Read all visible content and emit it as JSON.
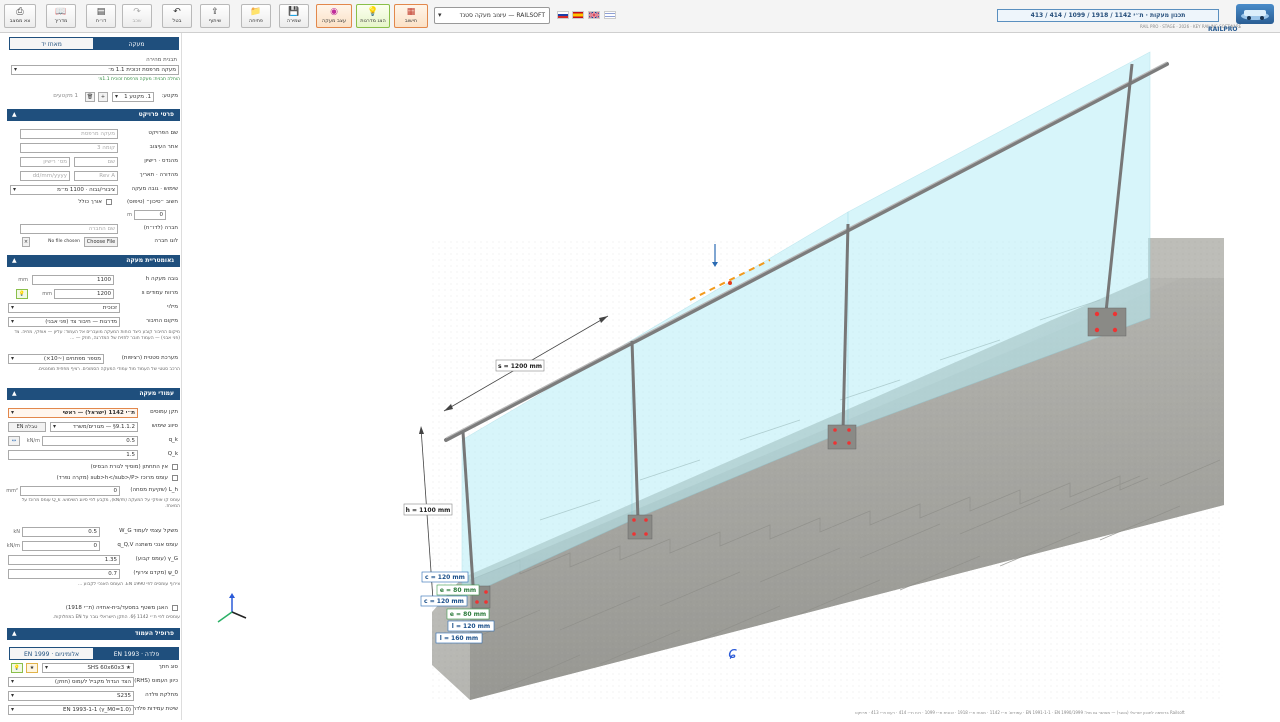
{
  "toolbar": {
    "buttons": [
      {
        "name": "export-pdf-button",
        "icon": "⎙",
        "label": "צא ממצב"
      },
      {
        "name": "guide-button",
        "icon": "📖",
        "label": "מדריך"
      },
      {
        "name": "report-button",
        "icon": "▤",
        "label": "דו״ח"
      },
      {
        "name": "redo-button",
        "icon": "↷",
        "label": "שכב"
      },
      {
        "name": "undo-button",
        "icon": "↶",
        "label": "בטל"
      },
      {
        "name": "share-button",
        "icon": "⇪",
        "label": "שיתוף"
      },
      {
        "name": "open-button",
        "icon": "📁",
        "label": "פתיחה"
      },
      {
        "name": "save-button",
        "icon": "💾",
        "label": "שמירה"
      },
      {
        "name": "design-railing-button",
        "icon": "◉",
        "label": "עצב מעקה"
      },
      {
        "name": "show-steps-button",
        "icon": "💡",
        "label": "הצג מדרגות"
      },
      {
        "name": "calc-button",
        "icon": "▦",
        "label": "חישוב"
      }
    ],
    "design_select": "RAILSOFT — עיצוב מעקה סטנד",
    "languages": [
      "RU",
      "ES",
      "UK",
      "IL"
    ]
  },
  "header": {
    "title": "תכנון מעקות · ת״י 1142 / 1918 / 1099 / 414 / 413",
    "sub": "RAIL PRO · STAGE · 2026 · KEY RAILING SOFTWARE",
    "corner_brand": "RAILPRO"
  },
  "panel": {
    "tabs": [
      "מעקה",
      "מאחז יד"
    ],
    "template_label": "תבנית מהירה",
    "template_value": "מעקה מרפסת זכוכית 1.1 מ׳",
    "template_note": "הוחלה תבנית: מעקה מרפסת זכוכית 1.1מ׳",
    "segment_label": "מקטע:",
    "segment_value": "1. מקטע 1",
    "segment_count": "1 מקטעים",
    "sections": {
      "project": "פרטי פרויקט",
      "geometry": "גאומטריית מעקה",
      "posts": "עמודי מעקה",
      "profile": "פרופיל העמוד"
    },
    "project": {
      "project_name_label": "שם הפרויקט",
      "project_name_ph": "מעקה מרפסת",
      "site_label": "אתר העיצוב",
      "site_ph": "קומה 3",
      "engineer_label": "מהנדס · רישיון",
      "engineer_name_ph": "שם",
      "engineer_lic_ph": "מס׳ רישיון",
      "revision_label": "מהדורה · תאריך",
      "revision_ph": "Rev A",
      "date_ph": "dd/mm/yyyy",
      "usage_label": "שימוש · גובה מעקה",
      "usage_value": "ציבורי/גבוה · 1100 מ״מ",
      "wind_label": "חשוב ״סיכון״ (טיפוס)",
      "wind_check": "אורך כולל",
      "wind_value": "0",
      "wind_unit": "m",
      "company_label": "חברה (לדו״ח)",
      "company_ph": "שם החברה",
      "logo_label": "לוגו חברה",
      "file_btn": "Choose File",
      "file_none": "No file chosen"
    },
    "geometry": {
      "height_label": "גובה מעקה h",
      "height_value": "1100",
      "height_unit": "mm",
      "spacing_label": "מרווח עמודים s",
      "spacing_value": "1200",
      "spacing_unit": "mm",
      "infill_label": "מילוי",
      "infill_value": "זכוכית",
      "mount_label": "מיקום החיבור",
      "mount_value": "מדרגות — חיבור צד (פני אבני)",
      "mount_note": "מיקום החיבור קובע כיצד כוחות המעקה מועברים אל העמוד: עליון — אופקי, מחיה. צד (פני אבני) — העמוד חובר לחזית של המדרגה, חוזק — ...",
      "system_label": "מערכת סטטית (רציפות)",
      "system_value": "מספר מפתחים (~10×)",
      "system_note": "הרכב סטטי של העמוד מול עמודי המעקה הסמוכים. רציף מפחית מומנטים."
    },
    "posts": {
      "standard_label": "תקן עמוסים",
      "standard_value": "ת״י 1142 (ישראל) — ראשי",
      "usage_cls_label": "סיווג שימוש",
      "usage_cls_value": "9.1.1.2§ — מגורים/משרד",
      "en_btn": "טבלת EN",
      "qk_label": "q_k",
      "qk_value": "0.5",
      "qk_unit": "kN/m",
      "qc_label": "Q_k",
      "qc_value": "1.5",
      "opt1": "אין התחתון (מוסיף לגורת הבסיס)",
      "opt2": "עומס מרוכז <sub>h</sub>/P (מקרה נפרד)",
      "load_label": "L_h (שקיעת מסחה)",
      "load_value": "0",
      "load_unit": "mm²",
      "load_note": "עומס קו אופקי על המעקה (kN/m), מקבע לפי סיווג השימוש. Q_k עומס מרוכז על המאחז.",
      "self_label": "משקל עצמי לעמוד W_G",
      "self_value": "0.5",
      "self_unit": "kN",
      "wind2_label": "עומס אנכי משתנה q_Q,V",
      "wind2_value": "0",
      "wind2_unit": "kN/m",
      "gg_label": "γ_G (עומס קבוע)",
      "gg_value": "1.35",
      "gq_label": "ψ_0 (מקדם צירוף)",
      "gq_value": "0.7",
      "combo_note": "צירוף עומסים לפי 1990 EN. העומס האנכי לקבוע ...",
      "impact_label": "האגן משטף במסעד/בית-אחזיה (ת״י 1918)",
      "impact_note": "עומסים לפי ת״י 1142 §6. התקן הישראלי גובר על EN במחלוקות."
    },
    "profile": {
      "tabs": [
        "פלדה · EN 1993",
        "אלומיניום · EN 1999"
      ],
      "section_label": "סוג חתך",
      "section_value": "★ SHS 60x60x3",
      "orient_label": "כיוון העמוס (RHS)",
      "orient_value": "הצד הגדול מקביל לעמוס (חוזק)",
      "grade_label": "מחלקת פלדה",
      "grade_value": "S235",
      "method_label": "שיטת עמידות פלדה",
      "method_value": "EN 1993-1-1 (γ_M0=1.0)"
    }
  },
  "dimensions": {
    "spacing": "s = 1200 mm",
    "height": "h = 1100 mm",
    "cp": "c = 120 mm",
    "ep": "e = 80 mm",
    "cs": "c = 120 mm",
    "es": "e = 80 mm",
    "lp": "l = 120 mm",
    "ls": "l = 160 mm"
  },
  "footer": "Railsoft ברשימה לתכנון ישראלי (בסגר) — מאושר גם מול: EN 1991-1-1 · EN 1990/1999 · עמודים: ת״י 1142 · מאחז ת״י 1918 · זכוכית ת״י 1099 · רוח ת״י 414 · רעש ת״י 413 · פרויקט"
}
